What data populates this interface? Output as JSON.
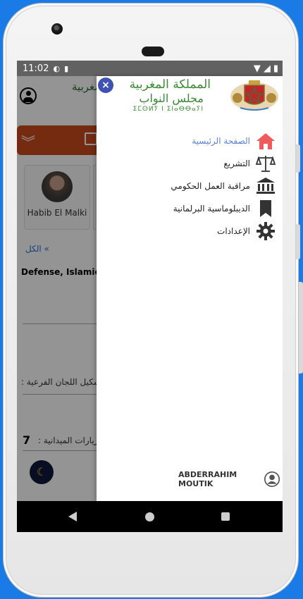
{
  "status_bar": {
    "time": "11:02"
  },
  "background_app": {
    "card_name": "Habib El Malki",
    "all_link": "الكل «",
    "row_text": "Defense, Islamic A",
    "label_subcommittees": "تشكيل اللجان الفرعية :",
    "label_field_visits": "الزيارات الميدانية :",
    "field_visits_value": "7",
    "logo_fragment": "مغربية"
  },
  "drawer": {
    "banner": {
      "line1": "المملكة المغربية",
      "line2": "مجلس النواب",
      "line3": "ⵉⵎⵙⵍⵢ ⵏ ⵉⵏⴰⴱⴱⴰⵢⵏ"
    },
    "close_label": "×",
    "menu": [
      {
        "label": "الصفحة الرئيسية",
        "icon": "home-icon",
        "active": true
      },
      {
        "label": "التشريع",
        "icon": "scales-icon",
        "active": false
      },
      {
        "label": "مراقبة العمل الحكومي",
        "icon": "institution-icon",
        "active": false
      },
      {
        "label": "الديبلوماسية البرلمانية",
        "icon": "bookmark-icon",
        "active": false
      },
      {
        "label": "الإعدادات",
        "icon": "gear-icon",
        "active": false
      }
    ],
    "user_name": "ABDERRAHIM MOUTIK"
  },
  "colors": {
    "active_menu": "#5b82d6",
    "home_icon": "#f05a5a",
    "close_button": "#3f51b5",
    "orange_bar": "#c84a1a"
  }
}
